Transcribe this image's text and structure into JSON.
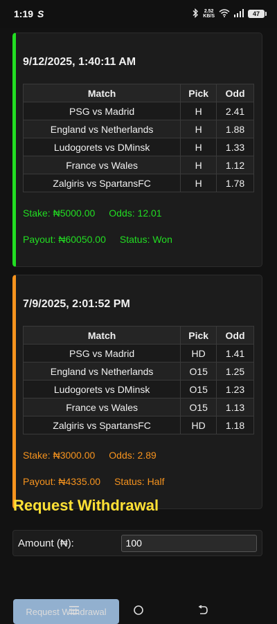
{
  "status_bar": {
    "time": "1:19",
    "app_glyph": "S",
    "speed_value": "2.52",
    "speed_unit": "KB/S",
    "battery": "47"
  },
  "bets": [
    {
      "date": "9/12/2025, 1:40:11 AM",
      "headers": [
        "Match",
        "Pick",
        "Odd"
      ],
      "rows": [
        {
          "match": "PSG vs Madrid",
          "pick": "H",
          "odd": "2.41"
        },
        {
          "match": "England vs Netherlands",
          "pick": "H",
          "odd": "1.88"
        },
        {
          "match": "Ludogorets vs DMinsk",
          "pick": "H",
          "odd": "1.33"
        },
        {
          "match": "France vs Wales",
          "pick": "H",
          "odd": "1.12"
        },
        {
          "match": "Zalgiris vs SpartansFC",
          "pick": "H",
          "odd": "1.78"
        }
      ],
      "stake": "Stake: ₦5000.00",
      "odds": "Odds: 12.01",
      "payout": "Payout: ₦60050.00",
      "status": "Status: Won",
      "accent": "#22dd22"
    },
    {
      "date": "7/9/2025, 2:01:52 PM",
      "headers": [
        "Match",
        "Pick",
        "Odd"
      ],
      "rows": [
        {
          "match": "PSG vs Madrid",
          "pick": "HD",
          "odd": "1.41"
        },
        {
          "match": "England vs Netherlands",
          "pick": "O15",
          "odd": "1.25"
        },
        {
          "match": "Ludogorets vs DMinsk",
          "pick": "O15",
          "odd": "1.23"
        },
        {
          "match": "France vs Wales",
          "pick": "O15",
          "odd": "1.13"
        },
        {
          "match": "Zalgiris vs SpartansFC",
          "pick": "HD",
          "odd": "1.18"
        }
      ],
      "stake": "Stake: ₦3000.00",
      "odds": "Odds: 2.89",
      "payout": "Payout: ₦4335.00",
      "status": "Status: Half",
      "accent": "#f6931e"
    }
  ],
  "withdrawal": {
    "title": "Request Withdrawal",
    "amount_label": "Amount (₦):",
    "amount_value": "100",
    "button_label": "Request Withdrawal"
  },
  "colors": {
    "background": "#121212",
    "card": "#1c1c1c",
    "title_yellow": "#ffe135",
    "button": "#a9ccf0"
  },
  "icons": {
    "bluetooth": "bluetooth-icon",
    "wifi": "wifi-icon",
    "signal": "signal-icon",
    "battery": "battery-icon",
    "nav_menu": "menu-icon",
    "nav_home": "home-icon",
    "nav_back": "back-icon"
  }
}
